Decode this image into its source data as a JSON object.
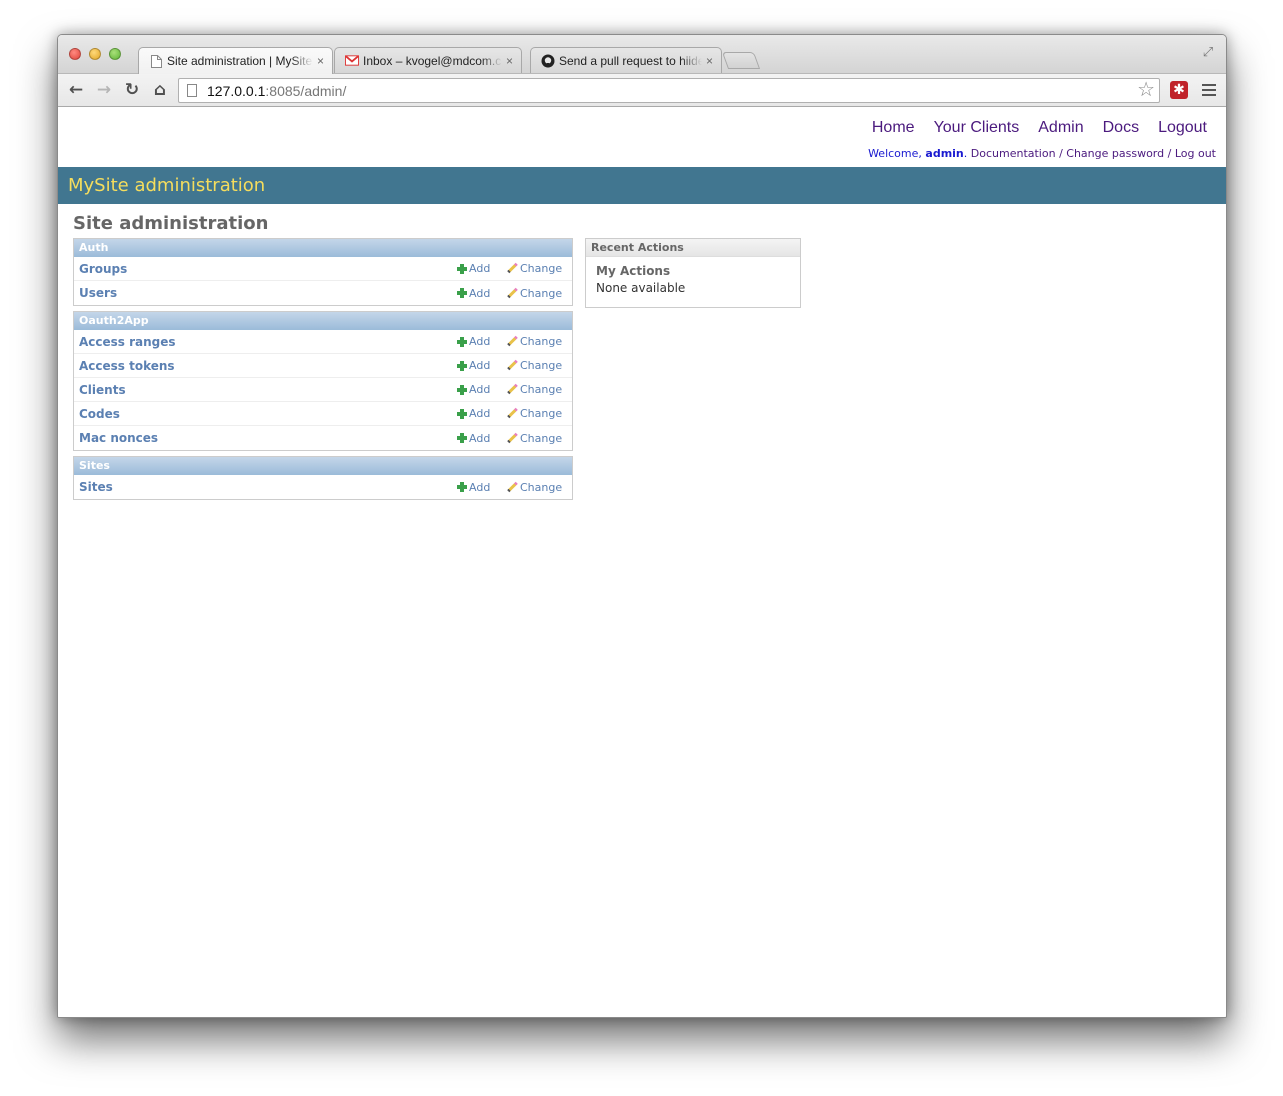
{
  "browser": {
    "tabs": [
      {
        "title": "Site administration | MySite admin",
        "icon": "document-icon",
        "active": true
      },
      {
        "title": "Inbox – kvogel@mdcom.com",
        "icon": "gmail-icon",
        "active": false
      },
      {
        "title": "Send a pull request to hiidef",
        "icon": "github-icon",
        "active": false
      }
    ],
    "close_glyph": "×",
    "address": {
      "host": "127.0.0.1",
      "rest": ":8085/admin/"
    },
    "nav_glyphs": {
      "back": "←",
      "forward": "→",
      "reload": "↻",
      "home": "⌂",
      "star": "☆",
      "fullscreen": "⤢",
      "ext": "✱"
    }
  },
  "site_nav": {
    "items": [
      "Home",
      "Your Clients",
      "Admin",
      "Docs",
      "Logout"
    ]
  },
  "user_tools": {
    "welcome": "Welcome, ",
    "username": "admin",
    "period": ".",
    "links": [
      "Documentation",
      "Change password",
      "Log out"
    ],
    "separator": " / "
  },
  "header": {
    "title": "MySite administration"
  },
  "content": {
    "title": "Site administration",
    "add_label": "Add",
    "change_label": "Change",
    "modules": [
      {
        "caption": "Auth",
        "models": [
          "Groups",
          "Users"
        ]
      },
      {
        "caption": "Oauth2App",
        "models": [
          "Access ranges",
          "Access tokens",
          "Clients",
          "Codes",
          "Mac nonces"
        ]
      },
      {
        "caption": "Sites",
        "models": [
          "Sites"
        ]
      }
    ]
  },
  "recent_actions": {
    "caption": "Recent Actions",
    "heading": "My Actions",
    "empty_text": "None available"
  },
  "colors": {
    "header_bg": "#417690",
    "header_text": "#f5dd5d",
    "link": "#5b80b2",
    "nav_link": "#4b1a7e",
    "add_icon": "#3aa04a"
  }
}
